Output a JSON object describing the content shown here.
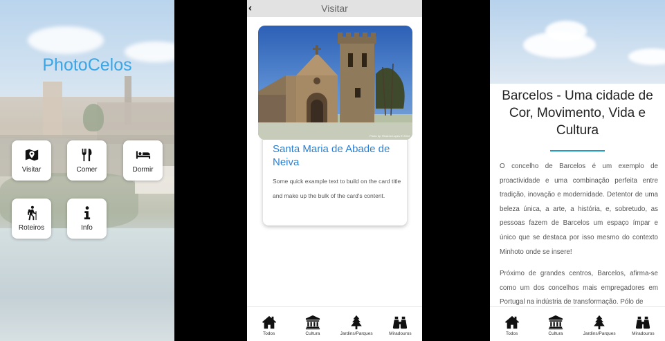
{
  "home": {
    "app_title": "PhotoCelos",
    "tiles": [
      {
        "label": "Visitar",
        "icon": "map-marker-icon"
      },
      {
        "label": "Comer",
        "icon": "utensils-icon"
      },
      {
        "label": "Dormir",
        "icon": "bed-icon"
      },
      {
        "label": "Roteiros",
        "icon": "hiker-icon"
      },
      {
        "label": "Info",
        "icon": "info-icon"
      }
    ]
  },
  "visitar": {
    "back": "‹",
    "title": "Visitar",
    "card": {
      "photo_credit": "Photo by: Ricardo Lopes © 2014",
      "title": "Santa Maria de Abade de Neiva",
      "text": "Some quick example text to build on the card title and make up the bulk of the card's content."
    }
  },
  "tabs": [
    {
      "label": "Todos",
      "icon": "home-icon"
    },
    {
      "label": "Cultura",
      "icon": "museum-icon"
    },
    {
      "label": "Jardins/Parques",
      "icon": "tree-icon"
    },
    {
      "label": "Miradouros",
      "icon": "binoculars-icon"
    }
  ],
  "article": {
    "title": "Barcelos - Uma cidade de Cor, Movimento, Vida e Cultura",
    "paragraphs": [
      "O concelho de Barcelos é um exemplo de proactividade e uma combinação perfeita entre tradição, inovação e modernidade. Detentor de uma beleza única, a arte, a história, e, sobretudo, as pessoas fazem de Barcelos um espaço ímpar e único que se destaca por isso mesmo do contexto Minhoto onde se insere!",
      "Próximo de grandes centros, Barcelos, afirma-se como um dos concelhos mais empregadores em Portugal na indústria de transformação. Pólo de"
    ]
  },
  "colors": {
    "accent_blue": "#3aa6e6",
    "card_title": "#2a7fd4",
    "rule": "#1aa0c8"
  }
}
